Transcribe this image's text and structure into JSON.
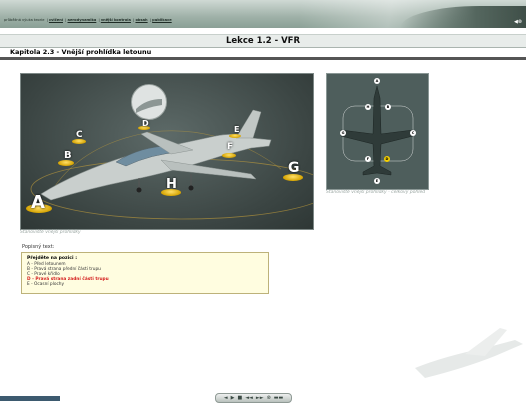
{
  "header": {
    "breadcrumb": [
      {
        "text": "průběžná výuka teorie",
        "link": false
      },
      {
        "text": "cvičení",
        "link": true
      },
      {
        "text": "aerodynamika",
        "link": true
      },
      {
        "text": "vnější kontrola",
        "link": true
      },
      {
        "text": "obsah",
        "link": true
      },
      {
        "text": "publikace",
        "link": true
      }
    ],
    "lesson_title": "Lekce 1.2 - VFR",
    "chapter_title": "Kapitola 2.3 - Vnější prohlídka letounu"
  },
  "main_image": {
    "caption": "Stanoviště vnější prohlídky",
    "points": [
      "A",
      "B",
      "C",
      "D",
      "E",
      "F",
      "G",
      "H"
    ]
  },
  "side_image": {
    "caption": "Stanoviště vnější prohlídky - celkový pohled",
    "points": [
      "A",
      "B",
      "C",
      "D",
      "E",
      "F",
      "G",
      "H"
    ],
    "active_point": "D"
  },
  "description": {
    "label": "Popisný text:",
    "heading": "Přejděte na pozici :",
    "rows": [
      {
        "text": "A - Před letounem",
        "active": false
      },
      {
        "text": "B - Pravá strana přední části trupu",
        "active": false
      },
      {
        "text": "C - Pravé křídlo",
        "active": false
      },
      {
        "text": "D - Pravá strana zadní části trupu",
        "active": true
      },
      {
        "text": "E - Ocasní plochy",
        "active": false
      }
    ]
  },
  "nav": {
    "buttons": [
      "◄",
      "▶",
      "■",
      "◄◄",
      "►►",
      "⊗",
      "▬▬"
    ]
  },
  "colors": {
    "accent": "#d41c1c",
    "marker": "#e8b800"
  }
}
